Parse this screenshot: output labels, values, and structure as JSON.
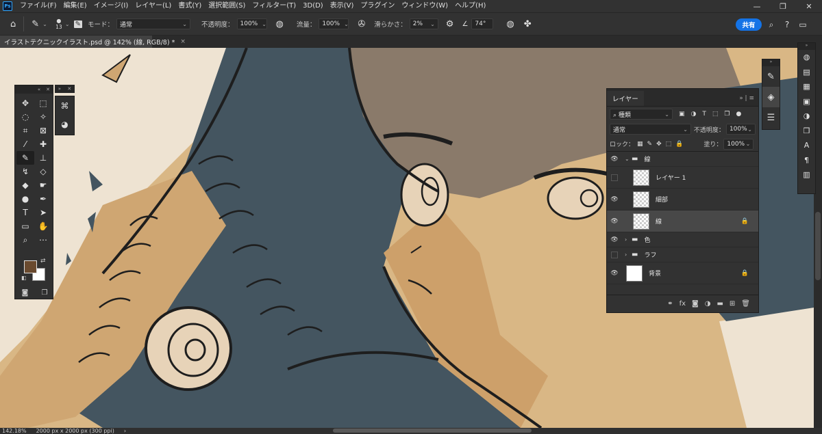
{
  "app": {
    "logo": "Ps"
  },
  "menu": [
    "ファイル(F)",
    "編集(E)",
    "イメージ(I)",
    "レイヤー(L)",
    "書式(Y)",
    "選択範囲(S)",
    "フィルター(T)",
    "3D(D)",
    "表示(V)",
    "プラグイン",
    "ウィンドウ(W)",
    "ヘルプ(H)"
  ],
  "options": {
    "brush_size": "13",
    "mode_label": "モード：",
    "mode_value": "通常",
    "opacity_label": "不透明度：",
    "opacity_value": "100%",
    "flow_label": "流量：",
    "flow_value": "100%",
    "smoothing_label": "滑らかさ：",
    "smoothing_value": "2%",
    "angle_value": "74°",
    "share_label": "共有"
  },
  "document_tab": {
    "title": "イラストテクニックイラスト.psd @ 142% (線, RGB/8) *",
    "close": "×"
  },
  "status": {
    "zoom": "142.18%",
    "doc_info": "2000 px x 2000 px (300 ppi)",
    "arrow": "›"
  },
  "layers_panel": {
    "tab_label": "レイヤー",
    "filter_label": "種類",
    "blend_mode": "通常",
    "opacity_label": "不透明度：",
    "opacity_value": "100%",
    "lock_label": "ロック：",
    "fill_label": "塗り：",
    "fill_value": "100%",
    "layers": [
      {
        "name": "線",
        "type": "group",
        "visible": true,
        "expanded": true
      },
      {
        "name": "レイヤー 1",
        "type": "layer",
        "visible": false
      },
      {
        "name": "細部",
        "type": "layer",
        "visible": true
      },
      {
        "name": "線",
        "type": "layer",
        "visible": true,
        "selected": true,
        "locked": true
      },
      {
        "name": "色",
        "type": "group",
        "visible": true,
        "expanded": false
      },
      {
        "name": "ラフ",
        "type": "group",
        "visible": false,
        "expanded": false
      },
      {
        "name": "背景",
        "type": "layer",
        "visible": true,
        "locked": true
      }
    ]
  },
  "colors": {
    "foreground": "#6a4a2f",
    "background": "#ffffff",
    "accent": "#1473e6"
  }
}
